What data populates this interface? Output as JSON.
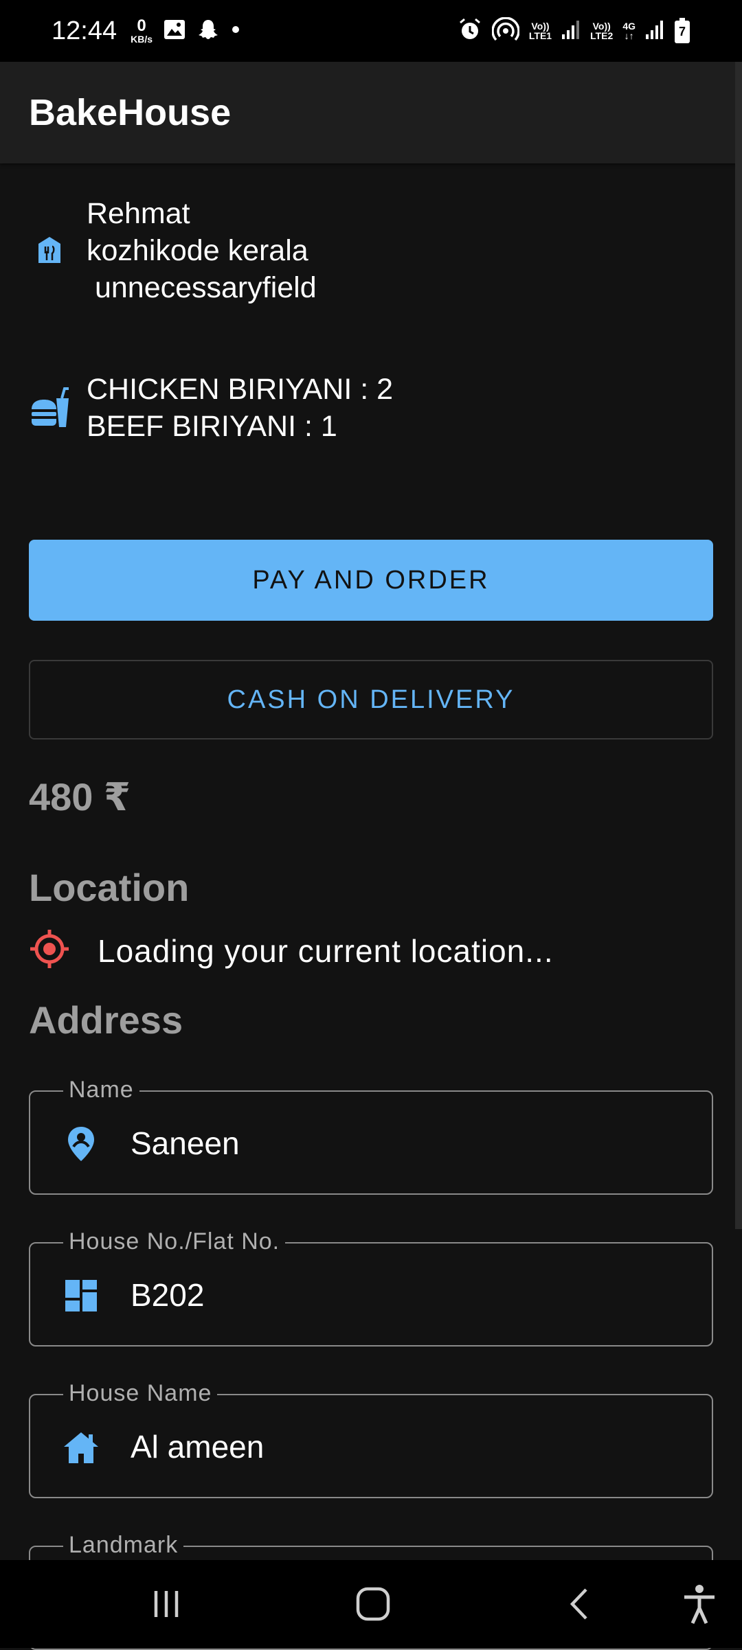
{
  "status_bar": {
    "time": "12:44",
    "speed_value": "0",
    "speed_unit": "KB/s",
    "sim1_line1": "Vo))",
    "sim1_line2": "LTE1",
    "sim2_line1": "Vo))",
    "sim2_line2": "LTE2",
    "network_type": "4G",
    "battery_level": "7",
    "icons": [
      "image-icon",
      "snapchat-icon",
      "dot-icon",
      "alarm-icon",
      "hotspot-icon",
      "signal-icon",
      "battery-icon"
    ]
  },
  "app_bar": {
    "title": "BakeHouse"
  },
  "restaurant": {
    "icon": "storefront-icon",
    "text": "Rehmat\nkozhikode kerala\n unnecessaryfield"
  },
  "order": {
    "icon": "fastfood-icon",
    "text": "CHICKEN BIRIYANI : 2\nBEEF BIRIYANI : 1"
  },
  "actions": {
    "pay_label": "PAY AND ORDER",
    "cod_label": "CASH ON DELIVERY"
  },
  "price": "480 ₹",
  "location": {
    "heading": "Location",
    "status": "Loading your current location..."
  },
  "address": {
    "heading": "Address",
    "fields": [
      {
        "label": "Name",
        "value": "Saneen",
        "icon": "person-pin-icon"
      },
      {
        "label": "House No./Flat No.",
        "value": "B202",
        "icon": "dashboard-icon"
      },
      {
        "label": "House Name",
        "value": "Al ameen",
        "icon": "house-icon"
      },
      {
        "label": "Landmark",
        "value": ""
      }
    ]
  },
  "colors": {
    "accent": "#64b5f6",
    "background": "#121212",
    "appbar": "#1e1e1e",
    "location_icon": "#ef5350",
    "muted_text": "#9e9e9e"
  }
}
